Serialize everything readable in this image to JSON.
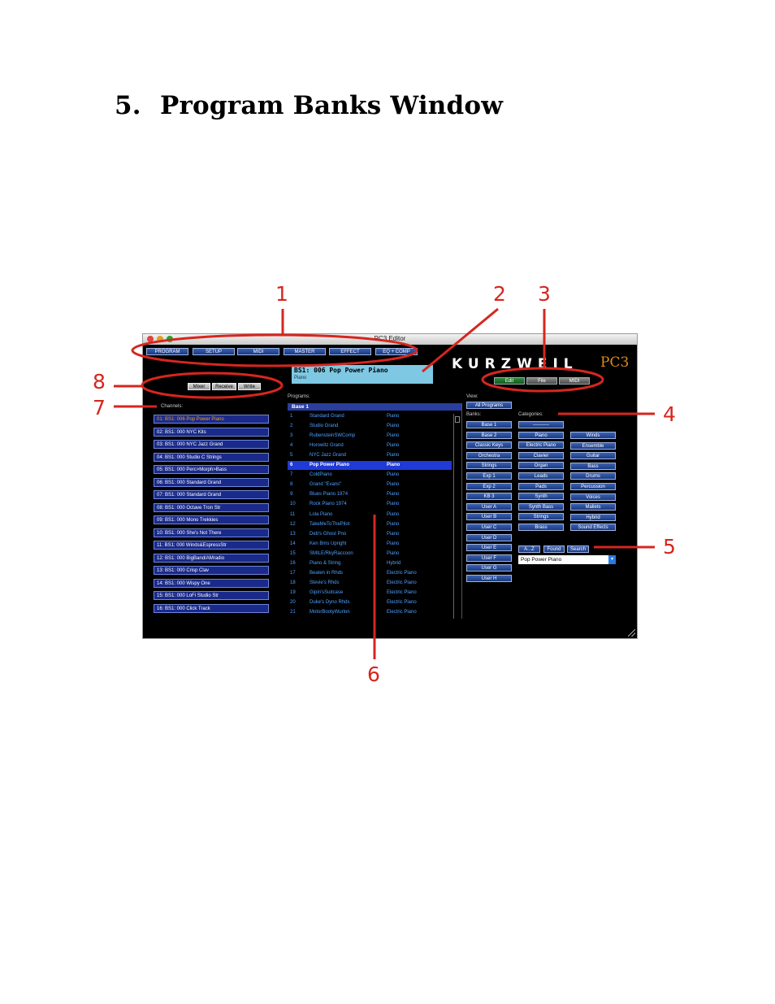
{
  "heading": {
    "number": "5.",
    "title": "Program Banks Window"
  },
  "window": {
    "title": "PC3 Editor",
    "top_buttons": [
      "PROGRAM",
      "SETUP",
      "MIDI",
      "MASTER",
      "EFFECT",
      "EQ + COMP"
    ],
    "grey_buttons": [
      "Mixer",
      "Receive",
      "Write"
    ],
    "mode_buttons": [
      "Edit",
      "File",
      "MIDI"
    ],
    "logo": "KURZWEIL",
    "logo_model": "PC3",
    "display": {
      "line1": "BS1: 006  Pop Power Piano",
      "line2": "Piano"
    },
    "channels_label": "Channels:",
    "channels": [
      "01:  BS1: 006   Pop Power Piano",
      "02:  BS1: 000   NYC Kits",
      "03:  BS1: 000   NYC Jazz Grand",
      "04:  BS1: 000   Studio C Strings",
      "05:  BS1: 000   Perc>Morph>Bass",
      "06:  BS1: 000   Standard Grand",
      "07:  BS1: 000   Standard Grand",
      "08:  BS1: 000   Octave Tron Str",
      "09:  BS1: 000   Mono Trekkies",
      "10:  BS1: 000   She's Not There",
      "11:  BS1: 000   Winds&EspressStr",
      "12:  BS1: 000   BigBand/AMradio",
      "13:  BS1: 000   Crisp Clav",
      "14:  BS1: 000   Wispy One",
      "15:  BS1: 000   LoFi Studio Str",
      "16:  BS1: 000   Click Track"
    ],
    "programs_label": "Programs:",
    "bank_header": "Base 1",
    "programs": [
      {
        "num": "1",
        "name": "Standard Grand",
        "cat": "Piano"
      },
      {
        "num": "2",
        "name": "Studio Grand",
        "cat": "Piano"
      },
      {
        "num": "3",
        "name": "RubensteinSWComp",
        "cat": "Piano"
      },
      {
        "num": "4",
        "name": "Horowitz Grand",
        "cat": "Piano"
      },
      {
        "num": "5",
        "name": "NYC Jazz Grand",
        "cat": "Piano"
      },
      {
        "num": "6",
        "name": "Pop Power Piano",
        "cat": "Piano"
      },
      {
        "num": "7",
        "name": "ColdPiano",
        "cat": "Piano"
      },
      {
        "num": "8",
        "name": "Grand  \"Evans\"",
        "cat": "Piano"
      },
      {
        "num": "9",
        "name": "Blues Piano 1974",
        "cat": "Piano"
      },
      {
        "num": "10",
        "name": "Rock Piano 1974",
        "cat": "Piano"
      },
      {
        "num": "11",
        "name": "Lola Piano",
        "cat": "Piano"
      },
      {
        "num": "12",
        "name": "TakeMeToThePilot",
        "cat": "Piano"
      },
      {
        "num": "13",
        "name": "Deb's  Ghost Pno",
        "cat": "Piano"
      },
      {
        "num": "14",
        "name": "Ken Bms Upright",
        "cat": "Piano"
      },
      {
        "num": "15",
        "name": "SMILE/RkyRaccoon",
        "cat": "Piano"
      },
      {
        "num": "16",
        "name": "Piano & String",
        "cat": "Hybrid"
      },
      {
        "num": "17",
        "name": "Beaten in Rhds",
        "cat": "Electric Piano"
      },
      {
        "num": "18",
        "name": "Stevie's Rhds",
        "cat": "Electric Piano"
      },
      {
        "num": "19",
        "name": "Gipin'sSuitcase",
        "cat": "Electric Piano"
      },
      {
        "num": "20",
        "name": "Duke's Dyno Rhds",
        "cat": "Electric Piano"
      },
      {
        "num": "21",
        "name": "MotorBootyWurlon",
        "cat": "Electric Piano"
      }
    ],
    "view_label": "View:",
    "all_programs": "All Programs",
    "banks_label": "Banks:",
    "banks": [
      "Base 1",
      "Base 2",
      "Classic Keys",
      "Orchestra",
      "Strings",
      "Exp 1",
      "Exp 2",
      "KB 3",
      "User A",
      "User B",
      "User C",
      "User D",
      "User E",
      "User F",
      "User G",
      "User H"
    ],
    "categories_label": "Categories:",
    "categories_col1": [
      "----------",
      "Piano",
      "Electric Piano",
      "Clavier",
      "Organ",
      "Leads",
      "Pads",
      "Synth",
      "Synth Bass",
      "Strings",
      "Brass"
    ],
    "categories_col2": [
      "Winds",
      "Ensemble",
      "Guitar",
      "Bass",
      "Drums",
      "Percussion",
      "Voices",
      "Mallets",
      "Hybrid",
      "Sound Effects"
    ],
    "search_buttons": [
      "A...Z",
      "Found",
      "Search"
    ],
    "search_value": "Pop Power Piano"
  },
  "callouts": [
    "1",
    "2",
    "3",
    "4",
    "5",
    "6",
    "7",
    "8"
  ]
}
